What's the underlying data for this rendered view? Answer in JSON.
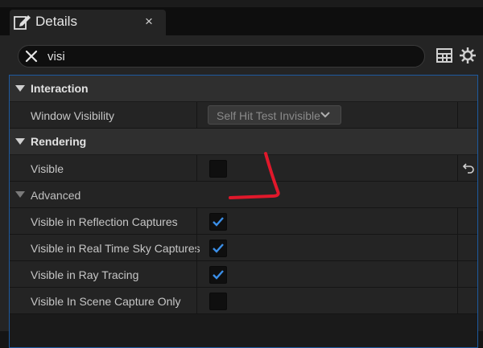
{
  "tab": {
    "title": "Details",
    "close": "×"
  },
  "search": {
    "value": "visi",
    "placeholder": ""
  },
  "toolbar": {
    "icons": [
      "table-icon",
      "gear-icon"
    ]
  },
  "sections": {
    "interaction": {
      "label": "Interaction"
    },
    "rendering": {
      "label": "Rendering"
    }
  },
  "properties": {
    "window_visibility": {
      "label": "Window Visibility",
      "value": "Self Hit Test Invisible"
    },
    "visible": {
      "label": "Visible",
      "checked": false
    },
    "advanced": {
      "label": "Advanced"
    },
    "reflection": {
      "label": "Visible in Reflection Captures",
      "checked": true
    },
    "sky": {
      "label": "Visible in Real Time Sky Captures",
      "checked": true
    },
    "raytracing": {
      "label": "Visible in Ray Tracing",
      "checked": true
    },
    "scene_capture": {
      "label": "Visible In Scene Capture Only",
      "checked": false
    }
  },
  "colors": {
    "accent": "#1d5aa0",
    "check": "#3b8fe8",
    "annotation": "#e0182b"
  }
}
